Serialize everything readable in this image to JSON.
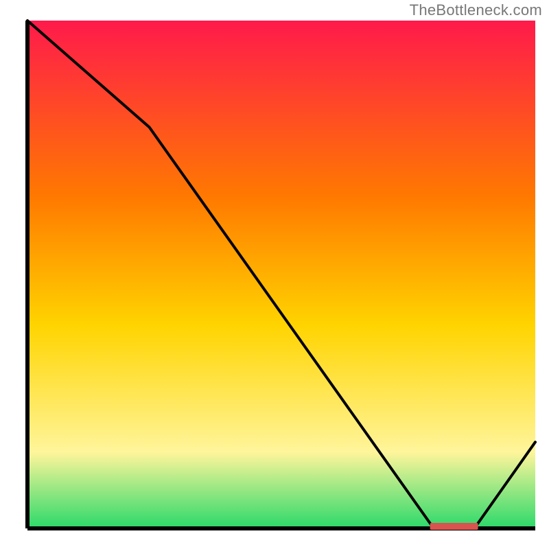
{
  "watermark": "TheBottleneck.com",
  "chart_data": {
    "type": "line",
    "title": "",
    "xlabel": "",
    "ylabel": "",
    "xlim": [
      0,
      100
    ],
    "ylim": [
      0,
      100
    ],
    "x": [
      0,
      24,
      80,
      88,
      100
    ],
    "values": [
      100,
      79,
      0,
      0,
      17
    ],
    "marker": {
      "x": 84,
      "y": 0,
      "color": "#d9534f"
    },
    "gradient_stops": {
      "top": "#ff1a4b",
      "mid_upper": "#ff7a00",
      "mid": "#ffd400",
      "mid_lower": "#fff59b",
      "bottom": "#2bd96a"
    },
    "axes_visible": {
      "x": true,
      "y": true,
      "ticks": false,
      "grid": false
    }
  }
}
